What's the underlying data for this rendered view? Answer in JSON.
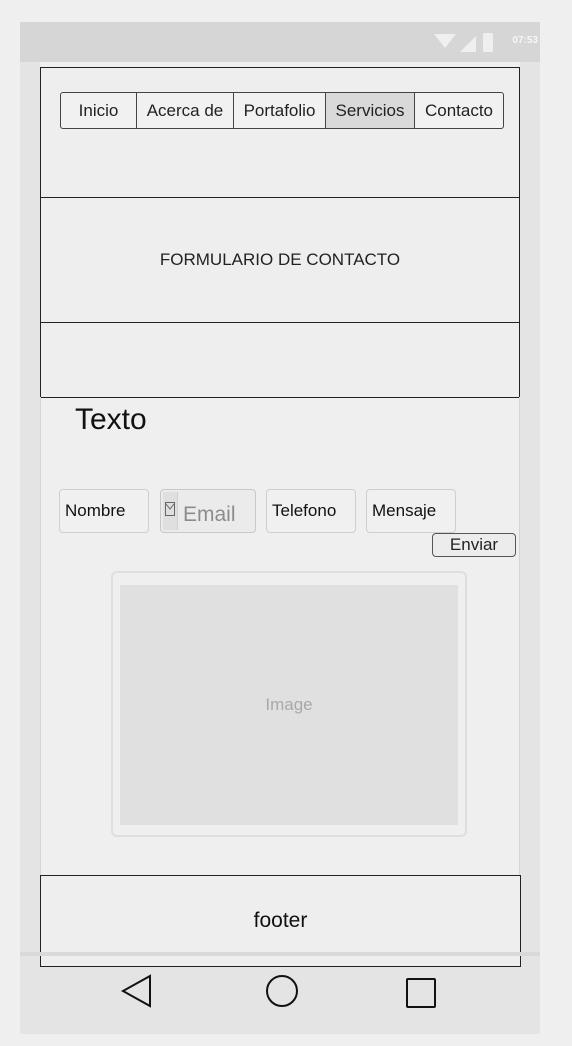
{
  "statusbar": {
    "time": "07:53",
    "icons": [
      "wifi-icon",
      "signal-icon",
      "battery-icon"
    ]
  },
  "nav": {
    "items": [
      {
        "label": "Inicio",
        "active": false
      },
      {
        "label": "Acerca de",
        "active": false
      },
      {
        "label": "Portafolio",
        "active": false
      },
      {
        "label": "Servicios",
        "active": true
      },
      {
        "label": "Contacto",
        "active": false
      }
    ]
  },
  "header": {
    "title": "FORMULARIO DE CONTACTO"
  },
  "main": {
    "heading": "Texto",
    "form": {
      "name_label": "Nombre",
      "email_placeholder": "Email",
      "phone_label": "Telefono",
      "message_label": "Mensaje",
      "send_label": "Enviar"
    },
    "image_label": "Image"
  },
  "footer": {
    "text": "footer"
  },
  "system_nav": {
    "icons": [
      "back-icon",
      "home-icon",
      "recents-icon"
    ]
  },
  "colors": {
    "background": "#efefef",
    "statusbar": "#d6d6d6",
    "active_tab": "#d9d9d9"
  }
}
